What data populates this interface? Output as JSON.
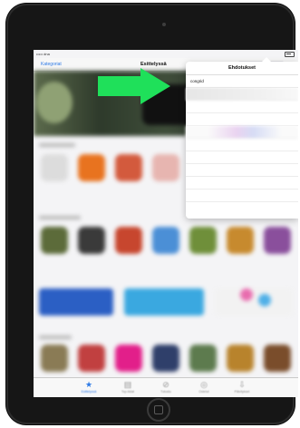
{
  "status_bar": {
    "carrier": "••••• dna",
    "time": ""
  },
  "nav": {
    "back_label": "Kategoriat",
    "title": "Esittelyssä",
    "search_value": "congrid"
  },
  "suggestions": {
    "header": "Ehdotukset",
    "items": [
      "congrid"
    ]
  },
  "tabs": [
    {
      "label": "Esittelyssä",
      "icon": "star-icon",
      "active": true
    },
    {
      "label": "Top-listat",
      "icon": "top-charts-icon",
      "active": false
    },
    {
      "label": "Tutustu",
      "icon": "compass-icon",
      "active": false
    },
    {
      "label": "Ostetut",
      "icon": "purchased-icon",
      "active": false
    },
    {
      "label": "Päivitykset",
      "icon": "updates-icon",
      "active": false
    }
  ],
  "colors": {
    "accent": "#2e7ae6",
    "arrow": "#1fe05a",
    "device": "#161616"
  }
}
